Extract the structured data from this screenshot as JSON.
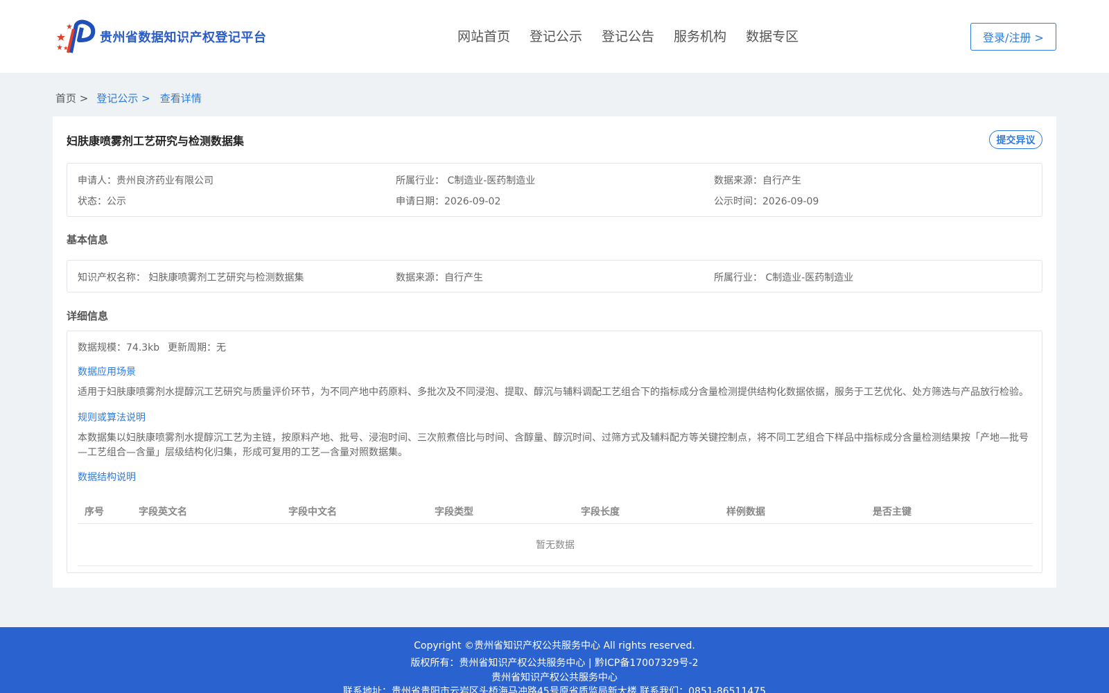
{
  "header": {
    "logo_text": "贵州省数据知识产权登记平台",
    "nav": [
      "网站首页",
      "登记公示",
      "登记公告",
      "服务机构",
      "数据专区"
    ],
    "login_label": "登录/注册 >"
  },
  "breadcrumb": {
    "home": "首页 >",
    "list": "登记公示 >",
    "current": "查看详情"
  },
  "record": {
    "title": "妇肤康喷雾剂工艺研究与检测数据集",
    "objection_label": "提交异议",
    "summary": {
      "applicant": "申请人：贵州良济药业有限公司",
      "industry": "所属行业： C制造业-医药制造业",
      "source": "数据来源：自行产生",
      "status": "状态：公示",
      "apply_date": "申请日期：2026-09-02",
      "publish_date": "公示时间：2026-09-09"
    }
  },
  "basic": {
    "section_title": "基本信息",
    "ip_name": "知识产权名称： 妇肤康喷雾剂工艺研究与检测数据集",
    "source": "数据来源：自行产生",
    "industry": "所属行业： C制造业-医药制造业"
  },
  "detail": {
    "section_title": "详细信息",
    "scale": "数据规模：74.3kb",
    "update_cycle": "更新周期：无",
    "scenario_title": "数据应用场景",
    "scenario_text": "适用于妇肤康喷雾剂水提醇沉工艺研究与质量评价环节，为不同产地中药原料、多批次及不同浸泡、提取、醇沉与辅料调配工艺组合下的指标成分含量检测提供结构化数据依据，服务于工艺优化、处方筛选与产品放行检验。",
    "rule_title": "规则或算法说明",
    "rule_text": "本数据集以妇肤康喷雾剂水提醇沉工艺为主链，按原料产地、批号、浸泡时间、三次煎煮倍比与时间、含醇量、醇沉时间、过筛方式及辅料配方等关键控制点，将不同工艺组合下样品中指标成分含量检测结果按「产地—批号—工艺组合—含量」层级结构化归集，形成可复用的工艺—含量对照数据集。",
    "structure_title": "数据结构说明",
    "table_headers": [
      "序号",
      "字段英文名",
      "字段中文名",
      "字段类型",
      "字段长度",
      "样例数据",
      "是否主键"
    ],
    "empty_text": "暂无数据"
  },
  "footer": {
    "copyright": "Copyright ©贵州省知识产权公共服务中心 All rights reserved.",
    "owner": "版权所有：贵州省知识产权公共服务中心 | 黔ICP备17007329号-2",
    "org": "贵州省知识产权公共服务中心",
    "contact": "联系地址：贵州省贵阳市云岩区头桥海马冲路45号原省质监局新大楼 联系我们：0851-86511475"
  }
}
